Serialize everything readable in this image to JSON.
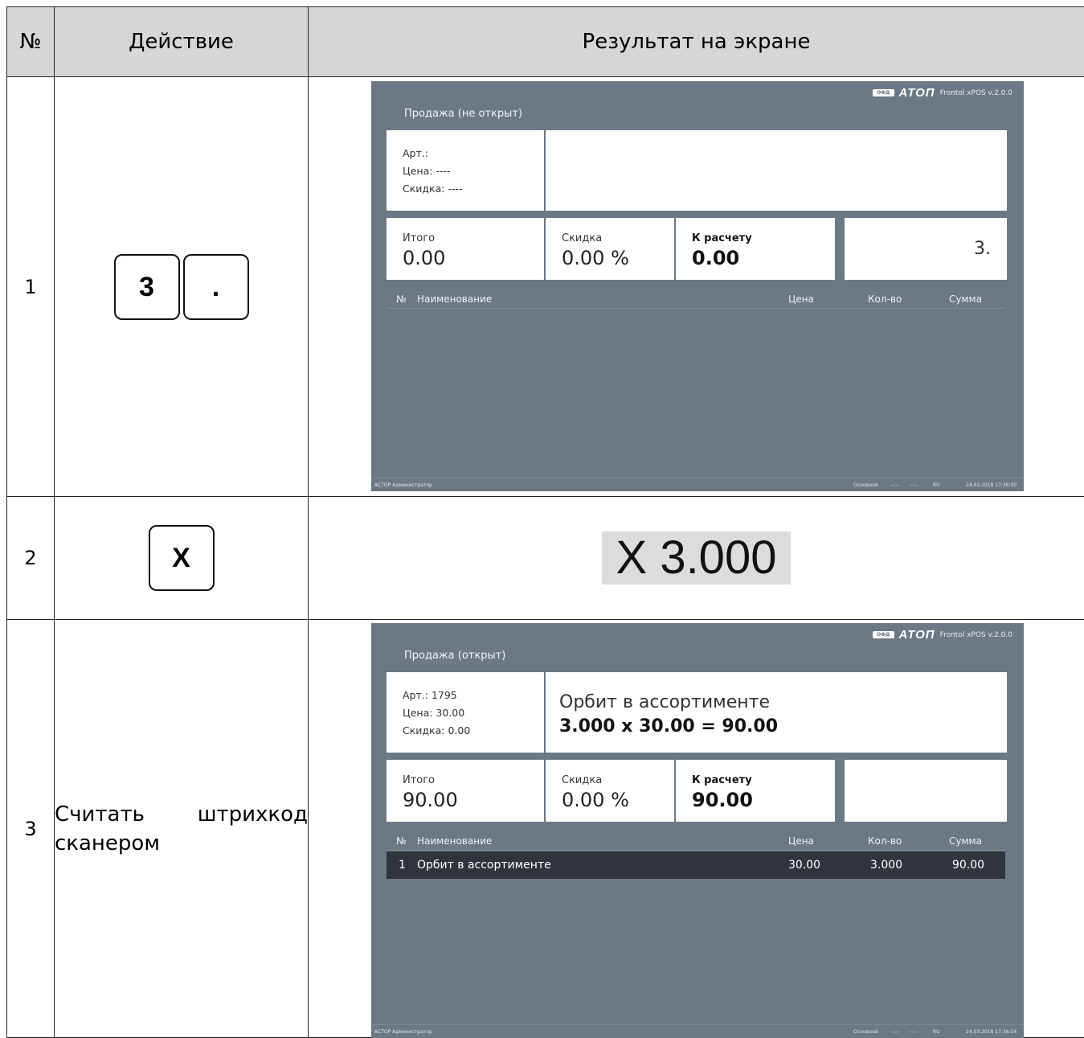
{
  "table": {
    "headers": [
      "№",
      "Действие",
      "Результат на экране"
    ],
    "rows": [
      {
        "num": "1",
        "keys": [
          "3",
          "."
        ],
        "screen": {
          "brand_ofd": "ОФД",
          "brand_name": "ATOΠ",
          "brand_version": "Frontol xPOS v.2.0.0",
          "mode": "Продажа (не открыт)",
          "art": "Арт.:",
          "price": "Цена:  ----",
          "discount": "Скидка:    ----",
          "product_name": "",
          "product_calc": "",
          "total_label": "Итого",
          "total_value": "0.00",
          "disc_label": "Скидка",
          "disc_value": "0.00 %",
          "pay_label": "К расчету",
          "pay_value": "0.00",
          "input_value": "3.",
          "columns": [
            "№",
            "Наименование",
            "Цена",
            "Кол-во",
            "Сумма"
          ],
          "items": [],
          "footer_left": "ACTOP  Администратор",
          "footer_mode": "Основной",
          "footer_dash1": "--:--",
          "footer_dash2": "--:--",
          "footer_lang": "RU",
          "footer_datetime": "24.03.2018 17:36:00"
        }
      },
      {
        "num": "2",
        "keys": [
          "X"
        ],
        "result_text": "X 3.000"
      },
      {
        "num": "3",
        "action_text": [
          "Считать",
          "штрихкод",
          "сканером"
        ],
        "screen": {
          "brand_ofd": "ОФД",
          "brand_name": "ATOΠ",
          "brand_version": "Frontol xPOS v.2.0.0",
          "mode": "Продажа (открыт)",
          "art": "Арт.: 1795",
          "price": "Цена:  30.00",
          "discount": "Скидка:    0.00",
          "product_name": "Орбит в ассортименте",
          "product_calc": "3.000 x 30.00 = 90.00",
          "total_label": "Итого",
          "total_value": "90.00",
          "disc_label": "Скидка",
          "disc_value": "0.00 %",
          "pay_label": "К расчету",
          "pay_value": "90.00",
          "input_value": "",
          "columns": [
            "№",
            "Наименование",
            "Цена",
            "Кол-во",
            "Сумма"
          ],
          "items": [
            {
              "num": "1",
              "name": "Орбит в ассортименте",
              "price": "30.00",
              "qty": "3.000",
              "sum": "90.00"
            }
          ],
          "footer_left": "ACTOP  Администратор",
          "footer_mode": "Основной",
          "footer_dash1": "--:--",
          "footer_dash2": "--:--",
          "footer_lang": "RU",
          "footer_datetime": "24.03.2018 17:36:54"
        }
      }
    ]
  }
}
